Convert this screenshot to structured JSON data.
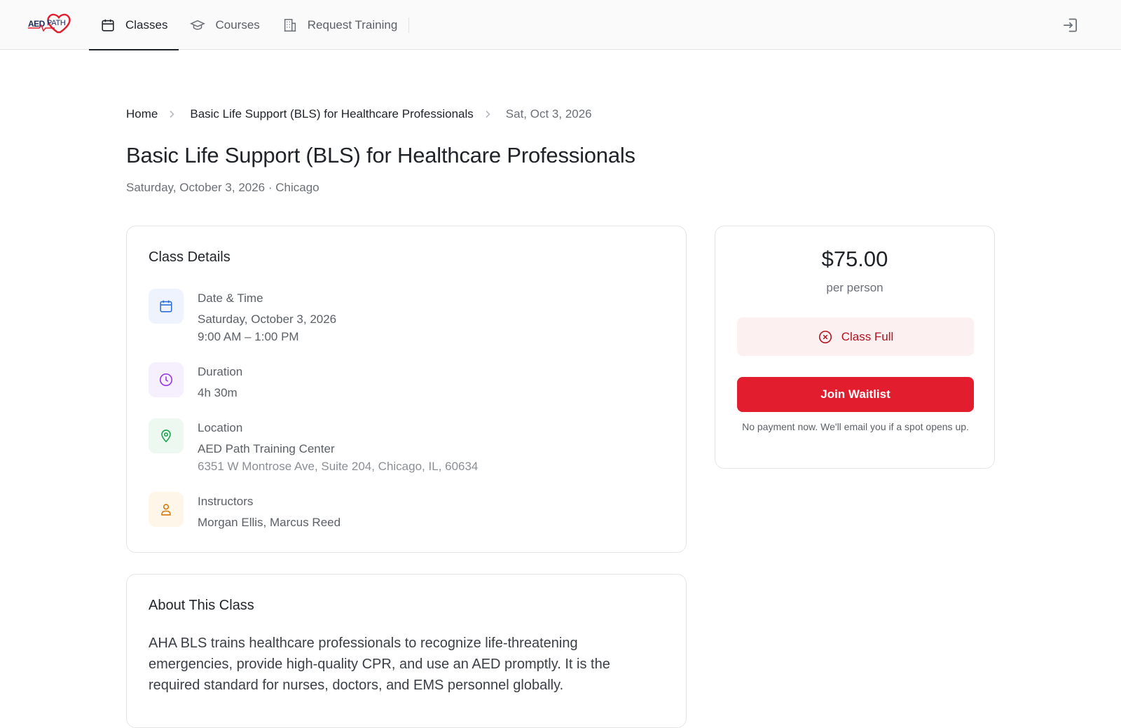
{
  "header": {
    "logo_text": "AEDPATH",
    "nav": [
      {
        "label": "Classes",
        "icon": "calendar-icon",
        "active": true
      },
      {
        "label": "Courses",
        "icon": "graduation-cap-icon",
        "active": false
      },
      {
        "label": "Request Training",
        "icon": "building-icon",
        "active": false
      }
    ],
    "sign_in_icon": "sign-in-icon"
  },
  "breadcrumb": [
    "Home",
    "Basic Life Support (BLS) for Healthcare Professionals",
    "Sat, Oct 3, 2026"
  ],
  "page": {
    "title": "Basic Life Support (BLS) for Healthcare Professionals",
    "subtitle": "Saturday, October 3, 2026 · Chicago"
  },
  "details": {
    "heading": "Class Details",
    "date": {
      "label": "Date & Time",
      "value": "Saturday, October 3, 2026",
      "time": "9:00 AM – 1:00 PM",
      "icon": "calendar-icon",
      "color": "#2f6fdb",
      "bg": "#eef3fd"
    },
    "duration": {
      "label": "Duration",
      "value": "4h 30m",
      "icon": "clock-icon",
      "color": "#9333ea",
      "bg": "#f6effd"
    },
    "location": {
      "label": "Location",
      "value": "AED Path Training Center",
      "address": "6351 W Montrose Ave, Suite 204, Chicago, IL, 60634",
      "icon": "map-pin-icon",
      "color": "#16a34a",
      "bg": "#ecf8f0"
    },
    "instructors": {
      "label": "Instructors",
      "value": "Morgan Ellis, Marcus Reed",
      "icon": "user-icon",
      "color": "#d97706",
      "bg": "#fdf6e9"
    }
  },
  "about": {
    "heading": "About This Class",
    "body": "AHA BLS trains healthcare professionals to recognize life-threatening emergencies, provide high-quality CPR, and use an AED promptly. It is the required standard for nurses, doctors, and EMS personnel globally."
  },
  "pricing": {
    "price": "$75.00",
    "per": "per person",
    "status": "Class Full",
    "status_icon": "x-circle-icon",
    "button": "Join Waitlist",
    "note": "No payment now. We'll email you if a spot opens up."
  },
  "colors": {
    "accent": "#e11d2e",
    "status_text": "#b3121f",
    "status_bg": "#fdf0f0"
  }
}
